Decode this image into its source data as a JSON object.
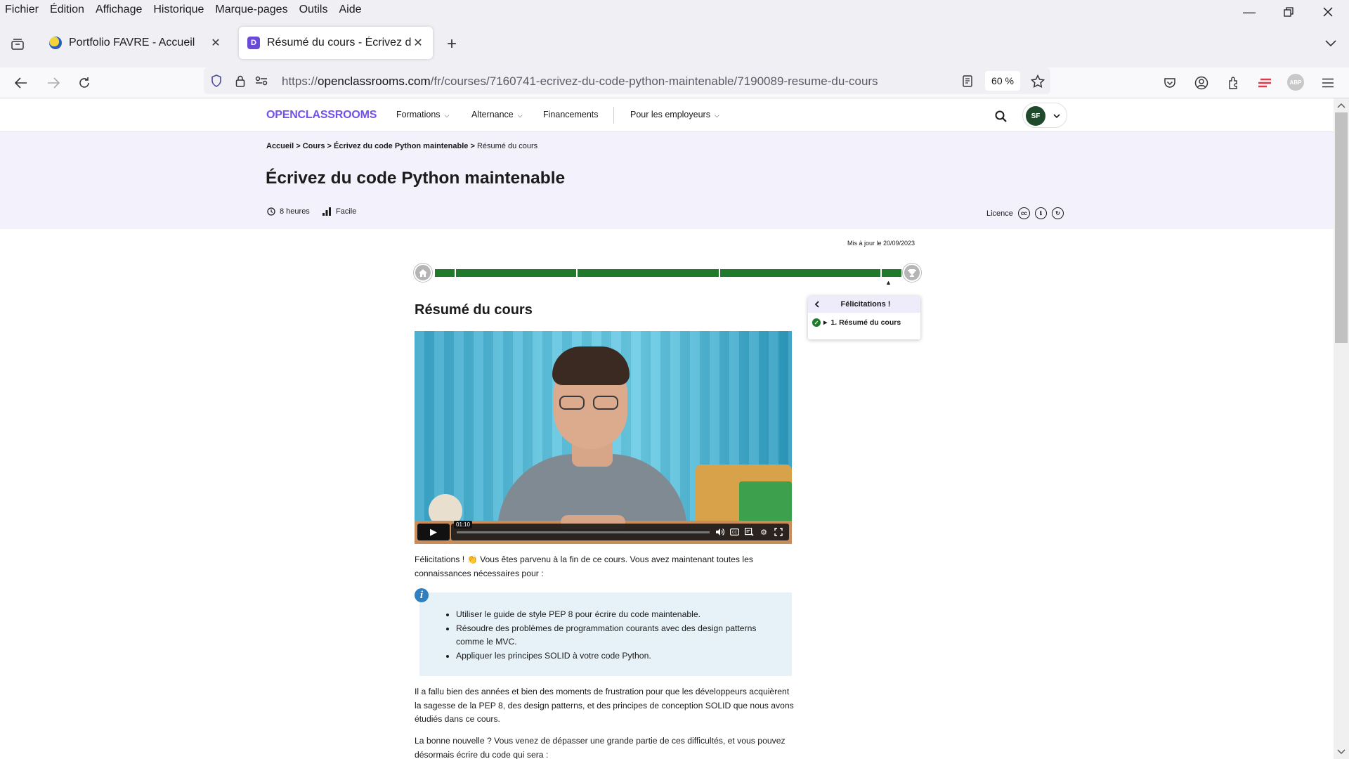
{
  "browser": {
    "menu": [
      "Fichier",
      "Édition",
      "Affichage",
      "Historique",
      "Marque-pages",
      "Outils",
      "Aide"
    ],
    "tabs": [
      {
        "title": "Portfolio FAVRE - Accueil"
      },
      {
        "title": "Résumé du cours - Écrivez du c"
      }
    ],
    "url_prefix": "https://",
    "url_host": "openclassrooms.com",
    "url_path": "/fr/courses/7160741-ecrivez-du-code-python-maintenable/7190089-resume-du-cours",
    "zoom": "60 %",
    "extension_abp": "ABP"
  },
  "site": {
    "logo": "OPENCLASSROOMS",
    "nav": [
      "Formations",
      "Alternance",
      "Financements",
      "Pour les employeurs"
    ],
    "avatar_initials": "SF"
  },
  "course": {
    "breadcrumb": [
      "Accueil",
      "Cours",
      "Écrivez du code Python maintenable"
    ],
    "breadcrumb_current": "Résumé du cours",
    "title": "Écrivez du code Python maintenable",
    "duration": "8 heures",
    "level": "Facile",
    "licence_label": "Licence",
    "updated": "Mis à jour le 20/09/2023",
    "progress_percent": 100
  },
  "toc": {
    "heading": "Félicitations !",
    "items": [
      "1. Résumé du cours"
    ]
  },
  "chapter": {
    "title": "Résumé du cours",
    "video_time": "01:10",
    "intro": "Félicitations ! 👏 Vous êtes parvenu à la fin de ce cours. Vous avez maintenant toutes les connaissances nécessaires pour :",
    "info_items": [
      "Utiliser le guide de style PEP 8 pour écrire du code maintenable.",
      "Résoudre des problèmes de programmation courants avec des design patterns comme le MVC.",
      "Appliquer les principes SOLID à votre code Python."
    ],
    "para2": "Il a fallu bien des années et bien des moments de frustration pour que les développeurs acquièrent la sagesse de la PEP 8, des design patterns, et des principes de conception SOLID que nous avons étudiés dans ce cours.",
    "para3": "La bonne nouvelle ? Vous venez de dépasser une grande partie de ces difficultés, et vous pouvez désormais écrire du code qui sera :"
  }
}
